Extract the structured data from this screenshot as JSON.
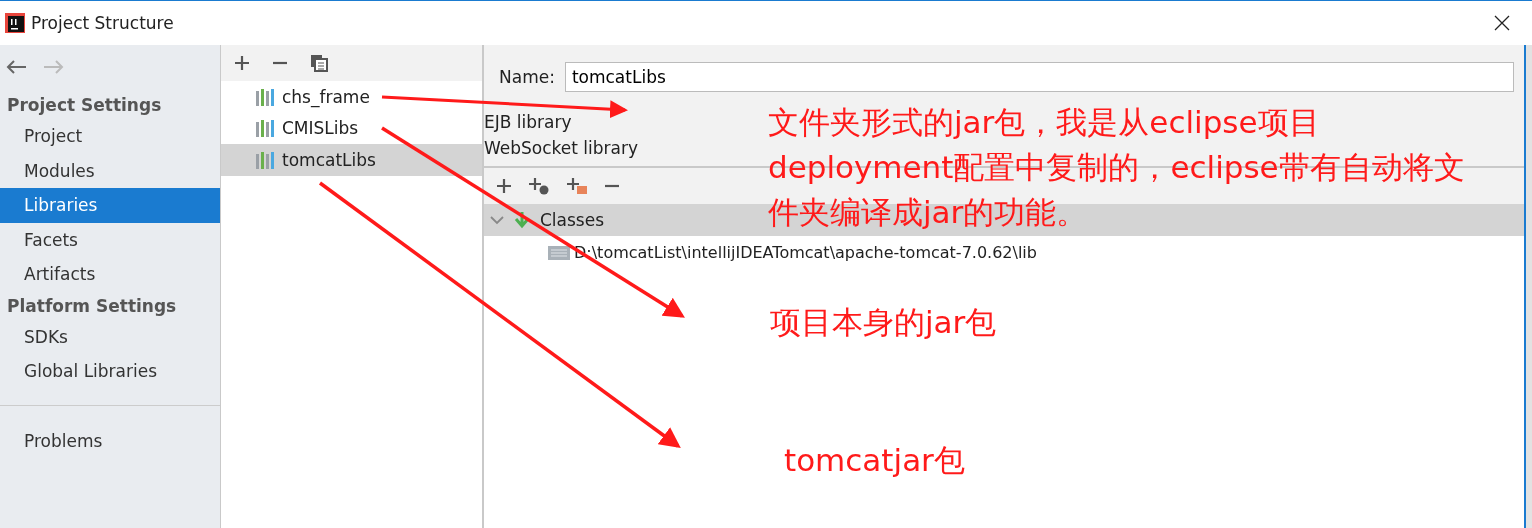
{
  "window": {
    "title": "Project Structure"
  },
  "sidebar": {
    "sections": [
      {
        "title": "Project Settings",
        "items": [
          {
            "label": "Project",
            "selected": false
          },
          {
            "label": "Modules",
            "selected": false
          },
          {
            "label": "Libraries",
            "selected": true
          },
          {
            "label": "Facets",
            "selected": false
          },
          {
            "label": "Artifacts",
            "selected": false
          }
        ]
      },
      {
        "title": "Platform Settings",
        "items": [
          {
            "label": "SDKs",
            "selected": false
          },
          {
            "label": "Global Libraries",
            "selected": false
          }
        ]
      }
    ],
    "bottom_items": [
      {
        "label": "Problems",
        "selected": false
      }
    ]
  },
  "libraries": [
    {
      "name": "chs_frame",
      "selected": false
    },
    {
      "name": "CMISLibs",
      "selected": false
    },
    {
      "name": "tomcatLibs",
      "selected": true
    }
  ],
  "details": {
    "name_label": "Name:",
    "name_value": "tomcatLibs",
    "types": [
      "EJB library",
      "WebSocket library"
    ],
    "tree": [
      {
        "label": "Classes",
        "expanded": true,
        "children": [
          {
            "label": "D:\\tomcatList\\intellijIDEATomcat\\apache-tomcat-7.0.62\\lib"
          }
        ]
      }
    ]
  },
  "annotations": [
    {
      "text": "文件夹形式的jar包，我是从eclipse项目deployment配置中复制的，eclipse带有自动将文件夹编译成jar的功能。"
    },
    {
      "text": "项目本身的jar包"
    },
    {
      "text": "tomcatjar包"
    }
  ]
}
